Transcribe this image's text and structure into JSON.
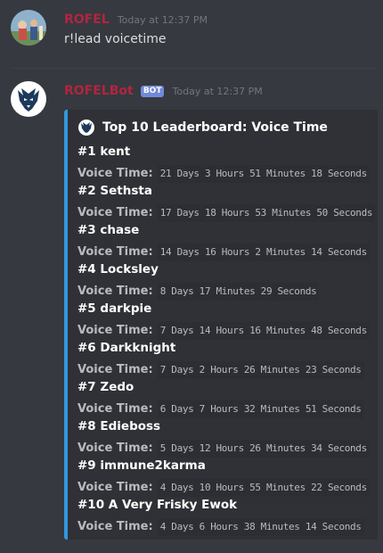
{
  "messages": [
    {
      "author": "ROFEL",
      "timestamp": "Today at 12:37 PM",
      "text": "r!lead voicetime"
    },
    {
      "author": "ROFELBot",
      "bot_tag": "BOT",
      "timestamp": "Today at 12:37 PM"
    }
  ],
  "embed": {
    "accent_color": "#3498db",
    "title": "Top 10 Leaderboard: Voice Time",
    "fields": [
      {
        "name": "#1 kent",
        "label": "Voice Time:",
        "value": "21 Days 3 Hours 51 Minutes 18 Seconds"
      },
      {
        "name": "#2 Sethsta",
        "label": "Voice Time:",
        "value": "17 Days 18 Hours 53 Minutes 50 Seconds"
      },
      {
        "name": "#3 chase",
        "label": "Voice Time:",
        "value": "14 Days 16 Hours 2 Minutes 14 Seconds"
      },
      {
        "name": "#4 Locksley",
        "label": "Voice Time:",
        "value": "8 Days 17 Minutes 29 Seconds"
      },
      {
        "name": "#5 darkpie",
        "label": "Voice Time:",
        "value": "7 Days 14 Hours 16 Minutes 48 Seconds"
      },
      {
        "name": "#6 Darkknight",
        "label": "Voice Time:",
        "value": "7 Days 2 Hours 26 Minutes 23 Seconds"
      },
      {
        "name": "#7 Zedo",
        "label": "Voice Time:",
        "value": "6 Days 7 Hours 32 Minutes 51 Seconds"
      },
      {
        "name": "#8 Edieboss",
        "label": "Voice Time:",
        "value": "5 Days 12 Hours 26 Minutes 34 Seconds"
      },
      {
        "name": "#9 immune2karma",
        "label": "Voice Time:",
        "value": "4 Days 10 Hours 55 Minutes 22 Seconds"
      },
      {
        "name": "#10 A Very Frisky Ewok",
        "label": "Voice Time:",
        "value": "4 Days 6 Hours 38 Minutes 14 Seconds"
      }
    ]
  }
}
